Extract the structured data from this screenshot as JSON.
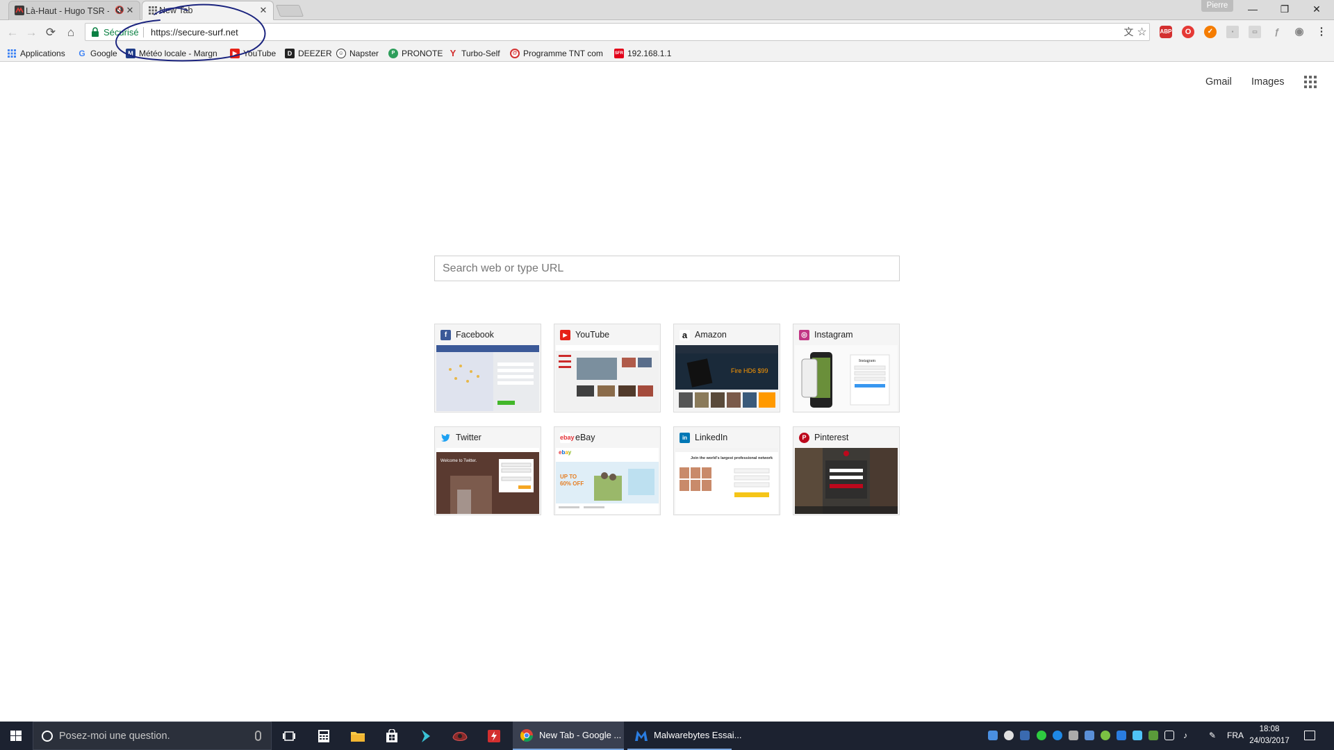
{
  "browser": {
    "tabs": [
      {
        "title": "Là-Haut - Hugo TSR -",
        "active": false,
        "muted": true
      },
      {
        "title": "New Tab",
        "active": true
      }
    ],
    "profile_name": "Pierre",
    "window_controls": {
      "minimize": "—",
      "restore": "❐",
      "close": "✕"
    },
    "nav": {
      "back": "←",
      "forward": "→",
      "reload": "⟳",
      "home": "⌂"
    },
    "omnibox": {
      "secure_label": "Sécurisé",
      "url": "https://secure-surf.net"
    },
    "extensions": [
      {
        "name": "translate-icon",
        "label": "文"
      },
      {
        "name": "star-icon",
        "label": "☆"
      },
      {
        "name": "adblock-plus-icon",
        "label": "ABP",
        "color": "#d32f2f"
      },
      {
        "name": "opera-icon",
        "label": "O",
        "color": "#e53935"
      },
      {
        "name": "orange-extension-icon",
        "label": "✓",
        "color": "#f57c00"
      },
      {
        "name": "puzzle-extension-icon",
        "label": "▪",
        "color": "#bdbdbd"
      },
      {
        "name": "gray-extension-icon",
        "label": "▭",
        "color": "#c7c7c7"
      },
      {
        "name": "feather-extension-icon",
        "label": "ƒ",
        "color": "#aaaaaa"
      },
      {
        "name": "circle-extension-icon",
        "label": "◉",
        "color": "#8a8a8a"
      },
      {
        "name": "menu-icon",
        "label": "⋮"
      }
    ]
  },
  "bookmarks": [
    {
      "label": "Applications",
      "icon": "apps-icon",
      "color": "#4285f4"
    },
    {
      "label": "Google",
      "icon": "google-icon",
      "color": "#ffffff"
    },
    {
      "label": "Météo locale - Margn",
      "icon": "weather-icon",
      "color": "#1f3c88"
    },
    {
      "label": "YouTube",
      "icon": "youtube-icon",
      "color": "#e62117"
    },
    {
      "label": "DEEZER",
      "icon": "deezer-icon",
      "color": "#222222"
    },
    {
      "label": "Napster",
      "icon": "napster-icon",
      "color": "#333333"
    },
    {
      "label": "PRONOTE",
      "icon": "pronote-icon",
      "color": "#2e9e5b"
    },
    {
      "label": "Turbo-Self",
      "icon": "turboself-icon",
      "color": "#d32f2f"
    },
    {
      "label": "Programme TNT com",
      "icon": "tnt-icon",
      "color": "#d32f2f"
    },
    {
      "label": "192.168.1.1",
      "icon": "sfr-icon",
      "color": "#e2001a"
    }
  ],
  "page": {
    "links": {
      "gmail": "Gmail",
      "images": "Images"
    },
    "search_placeholder": "Search web or type URL",
    "tiles": [
      {
        "label": "Facebook",
        "icon": "facebook-icon",
        "color": "#3b5998",
        "glyph": "f"
      },
      {
        "label": "YouTube",
        "icon": "youtube-icon",
        "color": "#e62117",
        "glyph": "▶"
      },
      {
        "label": "Amazon",
        "icon": "amazon-icon",
        "color": "#ffffff",
        "glyph": "a"
      },
      {
        "label": "Instagram",
        "icon": "instagram-icon",
        "color": "#c13584",
        "glyph": "◎"
      },
      {
        "label": "Twitter",
        "icon": "twitter-icon",
        "color": "#ffffff",
        "glyph": "🐦"
      },
      {
        "label": "eBay",
        "icon": "ebay-icon",
        "color": "#ffffff",
        "glyph": "e"
      },
      {
        "label": "LinkedIn",
        "icon": "linkedin-icon",
        "color": "#0077b5",
        "glyph": "in"
      },
      {
        "label": "Pinterest",
        "icon": "pinterest-icon",
        "color": "#bd081c",
        "glyph": "P"
      }
    ]
  },
  "taskbar": {
    "search_placeholder": "Posez-moi une question.",
    "tasks": [
      {
        "label": "New Tab - Google ...",
        "state": "active"
      },
      {
        "label": "Malwarebytes Essai...",
        "state": "open"
      }
    ],
    "language": "FRA",
    "time": "18:08",
    "date": "24/03/2017"
  }
}
